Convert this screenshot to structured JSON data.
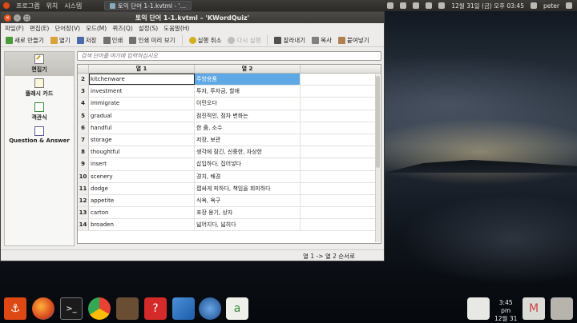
{
  "top_panel": {
    "menus": [
      "프로그램",
      "위치",
      "시스템"
    ],
    "task_button": "토익 단어 1-1.kvtml - '…",
    "clock": "12월 31일 (금) 오후 03:45",
    "user": "peter"
  },
  "window": {
    "title": "토익 단어 1-1.kvtml – 'KWordQuiz'",
    "menu": [
      "파일(F)",
      "편집(E)",
      "단어장(V)",
      "모드(M)",
      "퀴즈(Q)",
      "설정(S)",
      "도움말(H)"
    ],
    "toolbar": [
      {
        "label": "새로 만들기",
        "icon": "new-icon",
        "color": "#4a9a3a",
        "disabled": false
      },
      {
        "label": "열기",
        "icon": "open-icon",
        "color": "#d9a23a",
        "disabled": false
      },
      {
        "label": "저장",
        "icon": "save-icon",
        "color": "#4a6aa8",
        "disabled": false
      },
      {
        "label": "인쇄",
        "icon": "print-icon",
        "color": "#707070",
        "disabled": false
      },
      {
        "label": "인쇄 미리 보기",
        "icon": "print-preview-icon",
        "color": "#707070",
        "disabled": false
      },
      {
        "label": "실행 취소",
        "icon": "undo-icon",
        "color": "#d2b020",
        "disabled": false
      },
      {
        "label": "다시 실행",
        "icon": "redo-icon",
        "color": "#bdbdbd",
        "disabled": true
      },
      {
        "label": "잘라내기",
        "icon": "cut-icon",
        "color": "#505050",
        "disabled": false
      },
      {
        "label": "복사",
        "icon": "copy-icon",
        "color": "#808080",
        "disabled": false
      },
      {
        "label": "붙여넣기",
        "icon": "paste-icon",
        "color": "#b08050",
        "disabled": false
      }
    ],
    "sidebar": [
      {
        "label": "편집기",
        "icon": "edit-icon",
        "active": true
      },
      {
        "label": "플래시 카드",
        "icon": "flashcard-icon",
        "active": false
      },
      {
        "label": "객관식",
        "icon": "multiple-choice-icon",
        "active": false
      },
      {
        "label": "Question & Answer",
        "icon": "question-answer-icon",
        "active": false
      }
    ],
    "search_placeholder": "검색 단어를 여기에 입력하십시오",
    "columns": [
      "열 1",
      "열 2"
    ],
    "rows": [
      {
        "n": "2",
        "c1": "kitchenware",
        "c2": "주방용품"
      },
      {
        "n": "3",
        "c1": "investment",
        "c2": "투자, 투자금, 할애"
      },
      {
        "n": "4",
        "c1": "immigrate",
        "c2": "이민오다"
      },
      {
        "n": "5",
        "c1": "gradual",
        "c2": "점진적인, 점차 변화는"
      },
      {
        "n": "6",
        "c1": "handful",
        "c2": "한 줌, 소수"
      },
      {
        "n": "7",
        "c1": "storage",
        "c2": "저장, 보관"
      },
      {
        "n": "8",
        "c1": "thoughtful",
        "c2": "생각에 잠긴, 신중한, 자상한"
      },
      {
        "n": "9",
        "c1": "insert",
        "c2": "삽입하다, 집어넣다"
      },
      {
        "n": "10",
        "c1": "scenery",
        "c2": "경치, 배경"
      },
      {
        "n": "11",
        "c1": "dodge",
        "c2": "잽싸게 피하다, 책임을 회피하다"
      },
      {
        "n": "12",
        "c1": "appetite",
        "c2": "식욕, 욕구"
      },
      {
        "n": "13",
        "c1": "carton",
        "c2": "포장 용기, 상자"
      },
      {
        "n": "14",
        "c1": "broaden",
        "c2": "넓어지다, 넓히다"
      }
    ],
    "status": "열 1 -> 열 2 순서로"
  },
  "dock": {
    "clock_time": "3:45",
    "clock_ampm": "pm",
    "clock_date": "12월 31"
  }
}
